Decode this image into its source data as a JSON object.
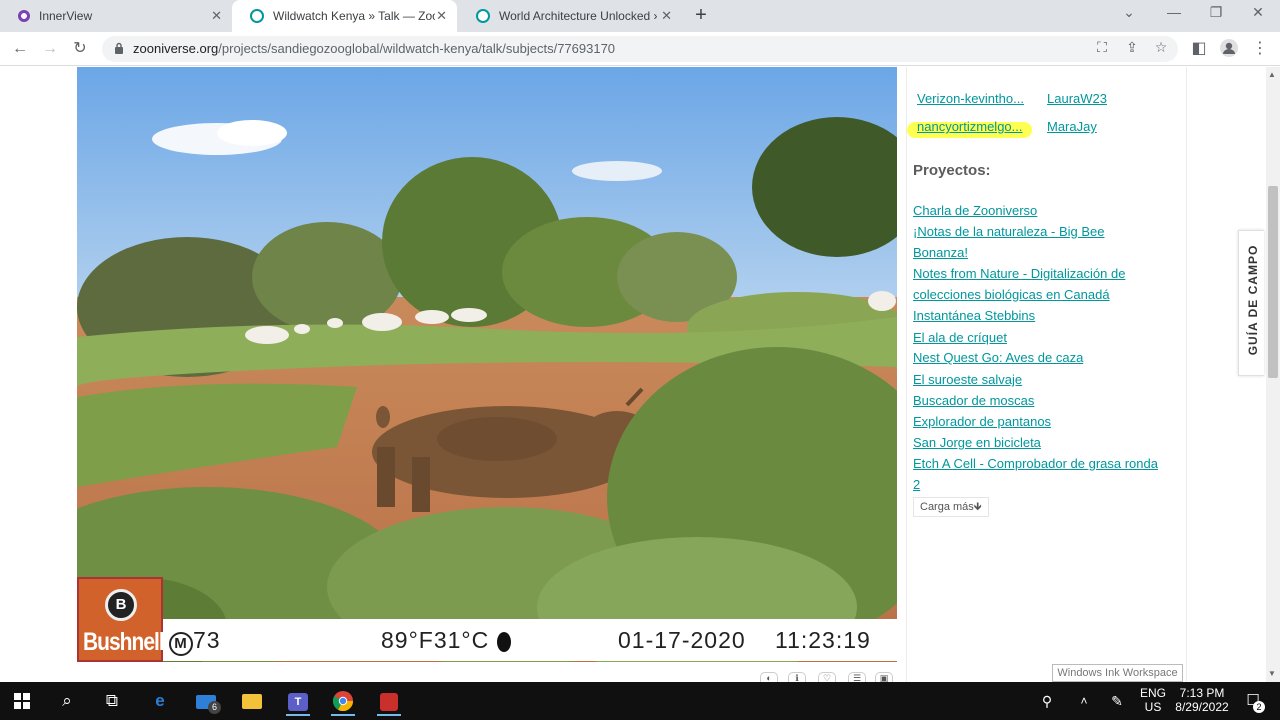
{
  "browser": {
    "tabs": [
      {
        "title": "InnerView",
        "icon": "innerview-icon",
        "color": "#7a3fb0"
      },
      {
        "title": "Wildwatch Kenya » Talk — Zooniverse",
        "icon": "zooniverse-icon",
        "color": "#00979d"
      },
      {
        "title": "World Architecture Unlocked » Talk",
        "icon": "zooniverse-icon",
        "color": "#00979d"
      }
    ],
    "new_tab": "+",
    "url_host": "zooniverse.org",
    "url_path": "/projects/sandiegozooglobal/wildwatch-kenya/talk/subjects/77693170"
  },
  "camera_stamp": {
    "brand": "Bushnell",
    "moon_label": "M",
    "frame": "73",
    "temperature": "89°F31°C",
    "date": "01-17-2020",
    "time": "11:23:19"
  },
  "sidebar": {
    "users": [
      {
        "name": "Verizon-kevintho..."
      },
      {
        "name": "LauraW23"
      },
      {
        "name": "nancyortizmelgo..."
      },
      {
        "name": "MaraJay"
      }
    ],
    "projects_title": "Proyectos:",
    "projects": [
      "Charla de Zooniverso",
      "¡Notas de la naturaleza - Big Bee",
      "Bonanza!",
      "Notes from Nature - Digitalización de",
      "colecciones biológicas en Canadá",
      "Instantánea Stebbins",
      "El ala de críquet",
      "Nest Quest Go: Aves de caza",
      "El suroeste salvaje",
      "Buscador de moscas",
      "Explorador de pantanos",
      "San Jorge en bicicleta",
      "Etch A Cell - Comprobador de grasa ronda",
      "2"
    ],
    "load_more": "Carga más🡻",
    "field_guide": "GUÍA DE CAMPO",
    "accent_color": "#00979d"
  },
  "ink_workspace_tooltip": "Windows Ink Workspace",
  "taskbar": {
    "mail_badge": "6",
    "language": "ENG",
    "region": "US",
    "time": "7:13 PM",
    "date": "8/29/2022",
    "notifications": "2"
  }
}
